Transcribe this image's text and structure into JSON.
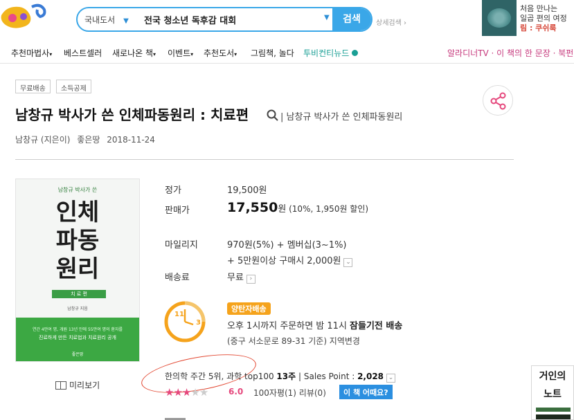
{
  "header": {
    "search_category": "국내도서",
    "search_query": "전국 청소년 독후감 대회",
    "search_button": "검색",
    "advanced_search": "상세검색",
    "promo": {
      "line1": "처음 만나는",
      "line2": "일곱 편의 여정",
      "line3": "림 : 쿠쉬룩"
    }
  },
  "nav": {
    "items": [
      "추천마법사",
      "베스트셀러",
      "새로나온 책",
      "이벤트",
      "추천도서",
      "그림책, 놀다",
      "투비컨티뉴드"
    ],
    "right": "알라디너TV · 이 책의 한 문장 · 북펀"
  },
  "badges": [
    "무료배송",
    "소득공제"
  ],
  "book": {
    "title": "남창규 박사가 쓴 인체파동원리 : 치료편",
    "subtitle": "| 남창규 박사가 쓴 인체파동원리",
    "author": "남창규 (지은이)",
    "publisher": "좋은땅",
    "date": "2018-11-24",
    "cover": {
      "author_line": "남창규 박사가 쓴",
      "title_line1": "인체",
      "title_line2": "파동",
      "title_line3": "원리",
      "sub": "치 료 편",
      "author_small": "남창규 지음",
      "band1": "연간 4만여 명, 개원 13년 만에 55만여 명의 환자를",
      "band2": "진료하게 만든 치료법과 치료원리 공개",
      "publisher": "좋은땅"
    },
    "preview_label": "미리보기"
  },
  "price": {
    "list_label": "정가",
    "list_value": "19,500원",
    "sale_label": "판매가",
    "sale_value": "17,550",
    "sale_unit": "원",
    "sale_detail": " (10%, 1,950원 할인)",
    "mileage_label": "마일리지",
    "mileage_value": "970원(5%) + 멤버십(3~1%)",
    "mileage_extra": "+ 5만원이상 구매시 2,000원",
    "shipping_label": "배송료",
    "shipping_value": "무료"
  },
  "delivery": {
    "badge": "양탄자배송",
    "line1_prefix": "오후 1시까지 주문하면 밤 11시 ",
    "line1_bold": "잠들기전 배송",
    "line2": "(중구 서소문로 89-31 기준) 지역변경",
    "clock_left": "11",
    "clock_right": "3"
  },
  "ranking": {
    "text": "한의학 주간 5위, 과학 top100 ",
    "weeks": "13주",
    "sep": " | Sales Point : ",
    "sales_point": "2,028"
  },
  "rating": {
    "stars_filled": 3,
    "stars_total": 5,
    "score": "6.0",
    "reviews": "100자평(1)  리뷰(0)",
    "how_button": "이 책 어때요?"
  },
  "side_ad": {
    "line1": "거인의",
    "line2": "노트"
  }
}
